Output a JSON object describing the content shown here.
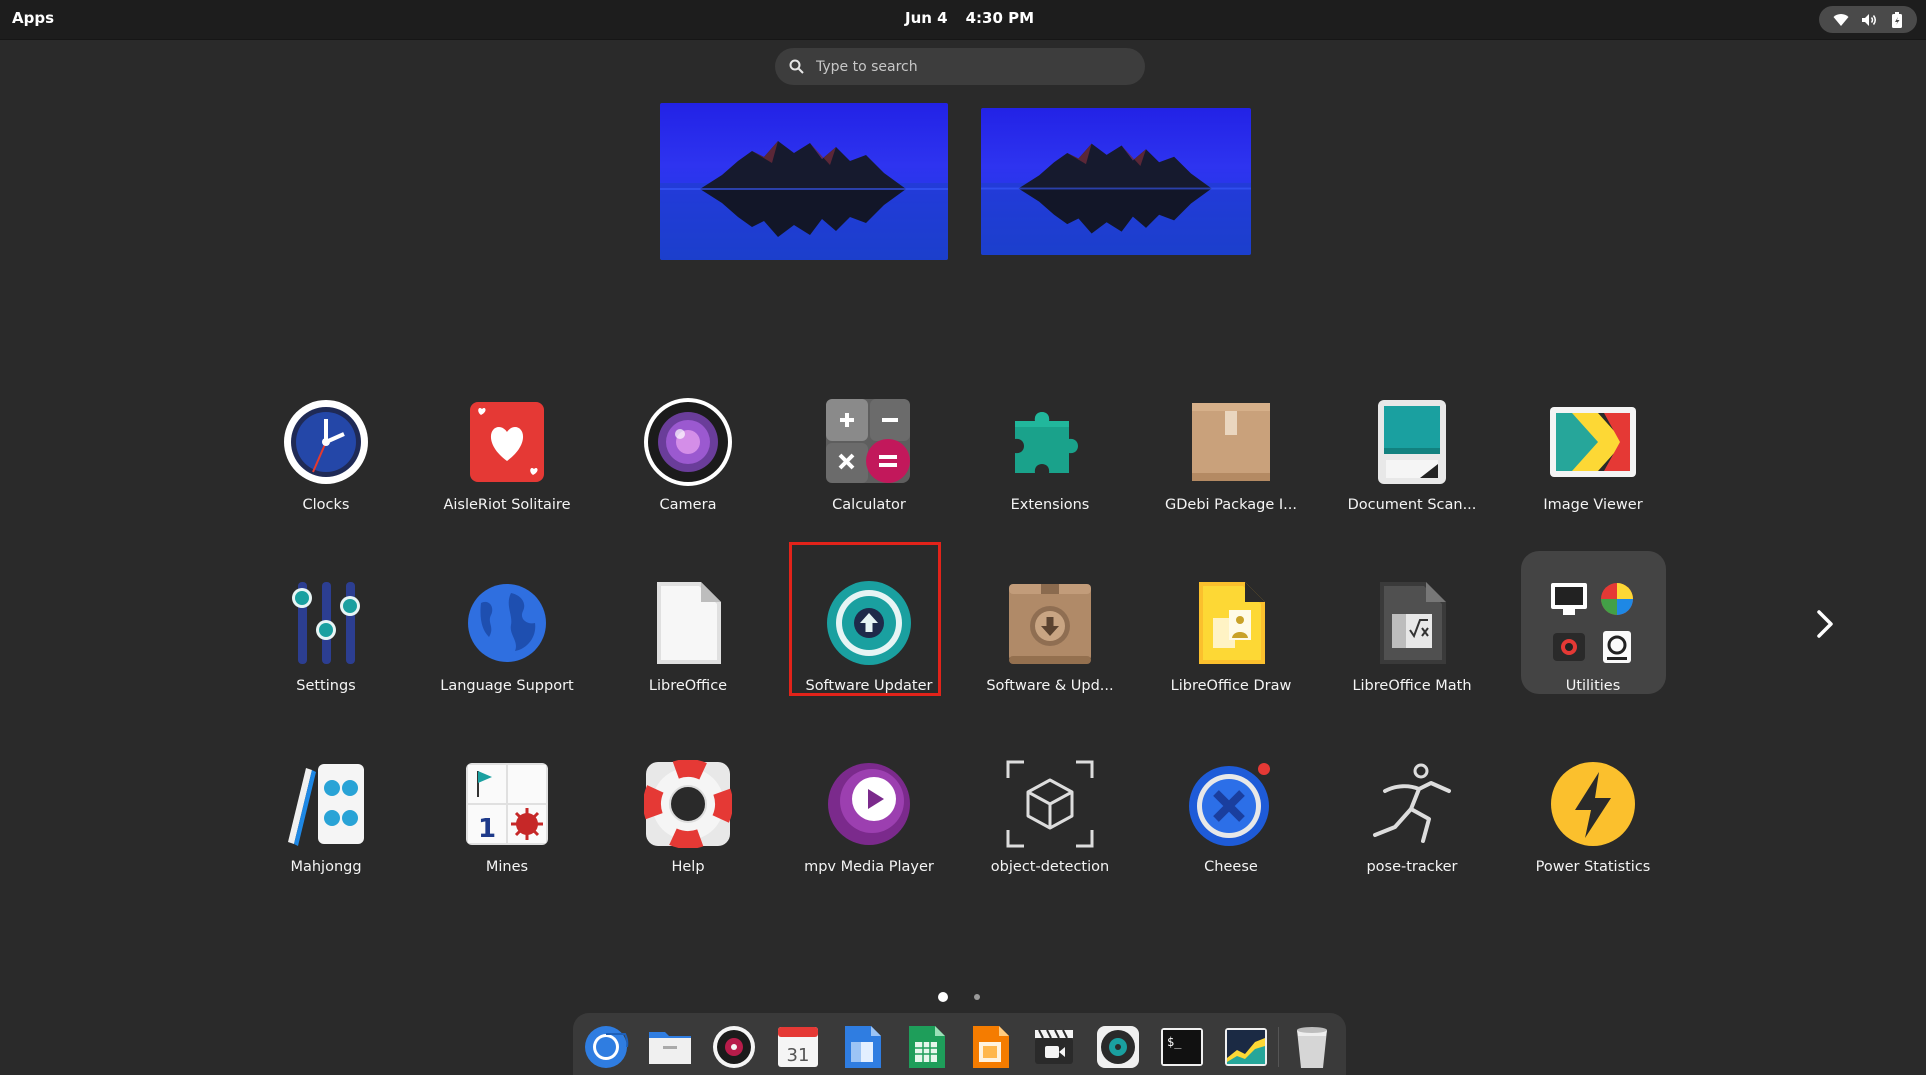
{
  "topbar": {
    "activities_label": "Apps",
    "date": "Jun 4",
    "time": "4:30 PM",
    "tray_icons": [
      "wifi-icon",
      "volume-icon",
      "battery-icon"
    ]
  },
  "search": {
    "placeholder": "Type to search",
    "value": ""
  },
  "workspaces": [
    "workspace-1",
    "workspace-2"
  ],
  "apps": [
    {
      "label": "Clocks",
      "icon": "clocks-icon"
    },
    {
      "label": "AisleRiot Solitaire",
      "icon": "solitaire-icon"
    },
    {
      "label": "Camera",
      "icon": "camera-icon"
    },
    {
      "label": "Calculator",
      "icon": "calculator-icon"
    },
    {
      "label": "Extensions",
      "icon": "puzzle-icon"
    },
    {
      "label": "GDebi Package I...",
      "icon": "package-icon"
    },
    {
      "label": "Document Scan...",
      "icon": "scanner-icon"
    },
    {
      "label": "Image Viewer",
      "icon": "image-viewer-icon"
    },
    {
      "label": "Settings",
      "icon": "settings-icon"
    },
    {
      "label": "Language Support",
      "icon": "globe-icon"
    },
    {
      "label": "LibreOffice",
      "icon": "libreoffice-icon"
    },
    {
      "label": "Software Updater",
      "icon": "software-updater-icon"
    },
    {
      "label": "Software & Upd...",
      "icon": "software-sources-icon"
    },
    {
      "label": "LibreOffice Draw",
      "icon": "libreoffice-draw-icon"
    },
    {
      "label": "LibreOffice Math",
      "icon": "libreoffice-math-icon"
    },
    {
      "label": "Utilities",
      "icon": "folder-icon"
    },
    {
      "label": "Mahjongg",
      "icon": "mahjongg-icon"
    },
    {
      "label": "Mines",
      "icon": "mines-icon"
    },
    {
      "label": "Help",
      "icon": "lifebuoy-icon"
    },
    {
      "label": "mpv Media Player",
      "icon": "mpv-icon"
    },
    {
      "label": "object-detection",
      "icon": "cube-icon"
    },
    {
      "label": "Cheese",
      "icon": "cheese-icon"
    },
    {
      "label": "pose-tracker",
      "icon": "running-figure-icon"
    },
    {
      "label": "Power Statistics",
      "icon": "power-icon"
    }
  ],
  "pagination": {
    "current_page": 1,
    "total_pages": 2
  },
  "dock": [
    "chromium-icon",
    "files-icon",
    "rhythmbox-icon",
    "calendar-icon",
    "writer-icon",
    "calc-icon",
    "impress-icon",
    "video-editor-icon",
    "disk-icon",
    "terminal-icon",
    "system-monitor-icon",
    "trash-icon"
  ],
  "calendar_day": "31",
  "terminal_prompt": "$_",
  "colors": {
    "background": "#2a2a2a",
    "highlight": "#e2231a",
    "topbar": "#1d1d1d"
  }
}
